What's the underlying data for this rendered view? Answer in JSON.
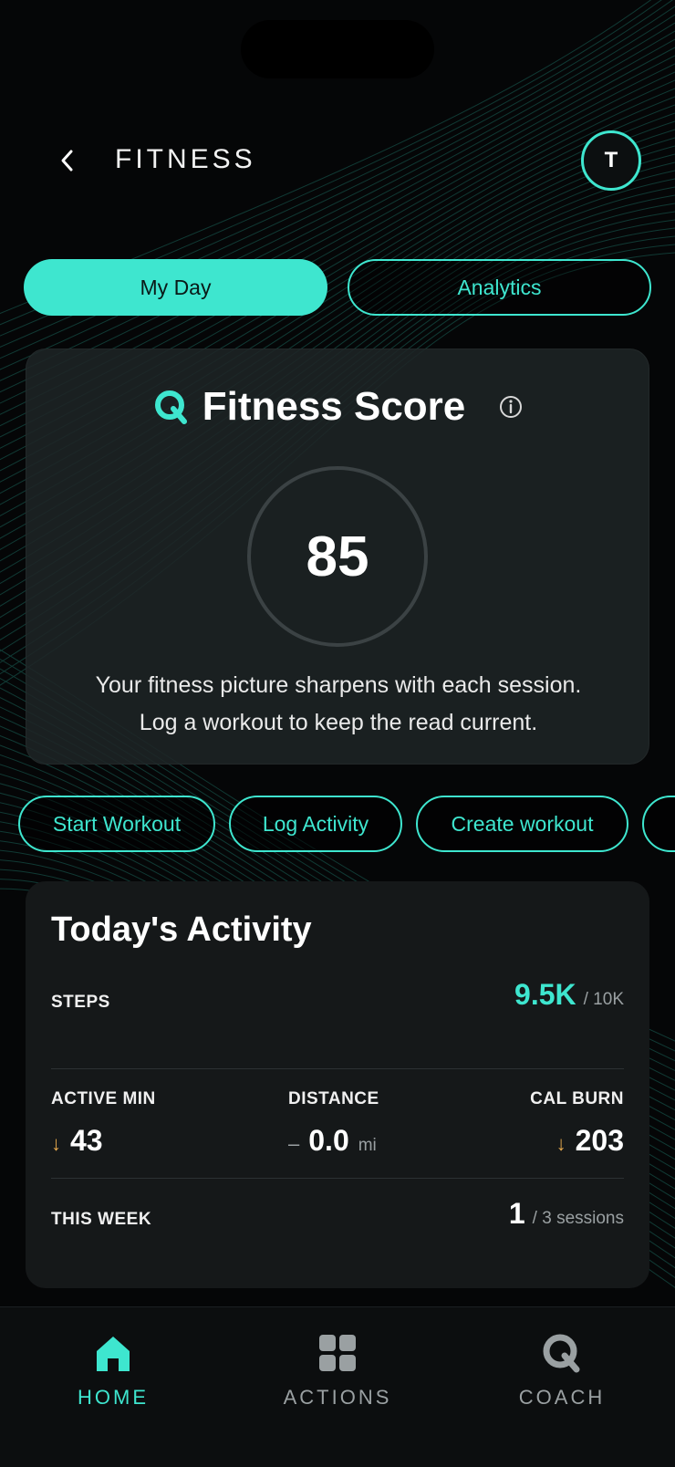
{
  "header": {
    "title": "FITNESS",
    "avatar_initial": "T"
  },
  "tabs": [
    {
      "label": "My Day",
      "active": true
    },
    {
      "label": "Analytics",
      "active": false
    }
  ],
  "score_card": {
    "title": "Fitness Score",
    "value": "85",
    "message_line1": "Your fitness picture sharpens with each session.",
    "message_line2": "Log a workout to keep the read current."
  },
  "quick_actions": [
    "Start Workout",
    "Log Activity",
    "Create workout",
    ""
  ],
  "activity": {
    "title": "Today's Activity",
    "steps": {
      "label": "STEPS",
      "value": "9.5K",
      "goal": "/ 10K"
    },
    "active_min": {
      "label": "ACTIVE MIN",
      "trend": "↓",
      "value": "43"
    },
    "distance": {
      "label": "DISTANCE",
      "trend": "–",
      "value": "0.0",
      "unit": "mi"
    },
    "cal_burn": {
      "label": "CAL BURN",
      "trend": "↓",
      "value": "203"
    },
    "this_week": {
      "label": "THIS WEEK",
      "value": "1",
      "goal": "/ 3 sessions"
    }
  },
  "bottom_nav": [
    {
      "label": "HOME",
      "icon": "home-icon",
      "active": true
    },
    {
      "label": "ACTIONS",
      "icon": "grid-icon",
      "active": false
    },
    {
      "label": "COACH",
      "icon": "coach-q-icon",
      "active": false
    }
  ],
  "colors": {
    "accent": "#3ee6cf",
    "background": "#050607",
    "card": "#151819",
    "trend_down": "#e5a84d"
  }
}
